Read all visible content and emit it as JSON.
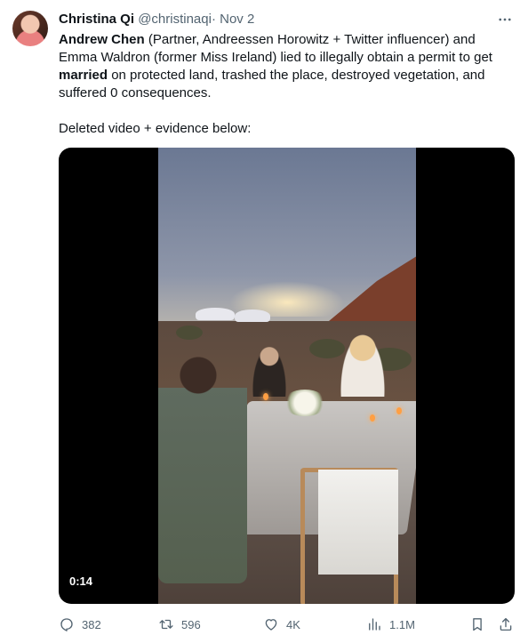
{
  "author": {
    "display_name": "Christina Qi",
    "handle": "@christinaqi",
    "separator": "·",
    "time": "Nov 2"
  },
  "tweet": {
    "p1_b1": "Andrew Chen",
    "p1_t1": " (Partner, Andreessen Horowitz + Twitter influencer) and Emma Waldron (former Miss Ireland) lied to illegally obtain a permit to get ",
    "p1_b2": "married",
    "p1_t2": " on protected land, trashed the place, destroyed vegetation, and suffered 0 consequences.",
    "p2": "Deleted video + evidence below:"
  },
  "media": {
    "duration": "0:14"
  },
  "actions": {
    "replies": "382",
    "retweets": "596",
    "likes": "4K",
    "views": "1.1M"
  },
  "icons": {
    "more": "more-horizontal-icon",
    "reply": "reply-icon",
    "retweet": "retweet-icon",
    "like": "heart-icon",
    "views": "analytics-icon",
    "bookmark": "bookmark-icon",
    "share": "share-icon"
  },
  "colors": {
    "text": "#0f1419",
    "secondary": "#536471",
    "media_bg": "#000000"
  }
}
